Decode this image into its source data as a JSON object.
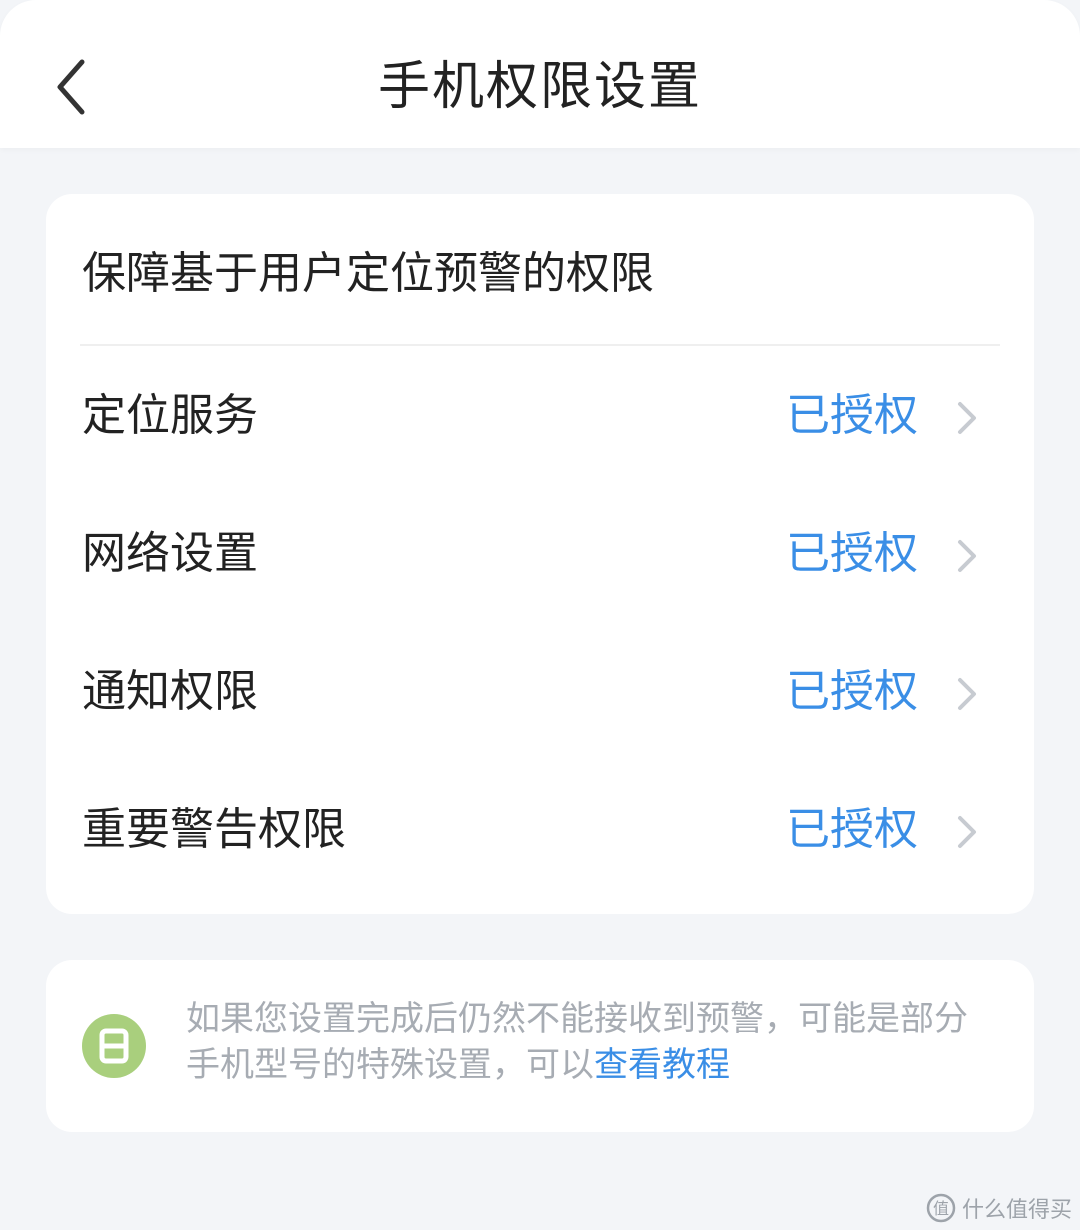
{
  "header": {
    "title": "手机权限设置",
    "back_icon": "chevron-left-icon"
  },
  "permissions": {
    "section_title": "保障基于用户定位预警的权限",
    "items": [
      {
        "label": "定位服务",
        "status": "已授权"
      },
      {
        "label": "网络设置",
        "status": "已授权"
      },
      {
        "label": "通知权限",
        "status": "已授权"
      },
      {
        "label": "重要警告权限",
        "status": "已授权"
      }
    ],
    "status_color": "#3a8ee6",
    "chevron_icon": "chevron-right-icon"
  },
  "tip": {
    "icon": "tip-badge-icon",
    "icon_color": "#a9cf7d",
    "text": "如果您设置完成后仍然不能接收到预警，可能是部分手机型号的特殊设置，可以",
    "link_text": "查看教程"
  },
  "watermark": {
    "icon": "zhidemai-logo-icon",
    "text": "什么值得买"
  }
}
